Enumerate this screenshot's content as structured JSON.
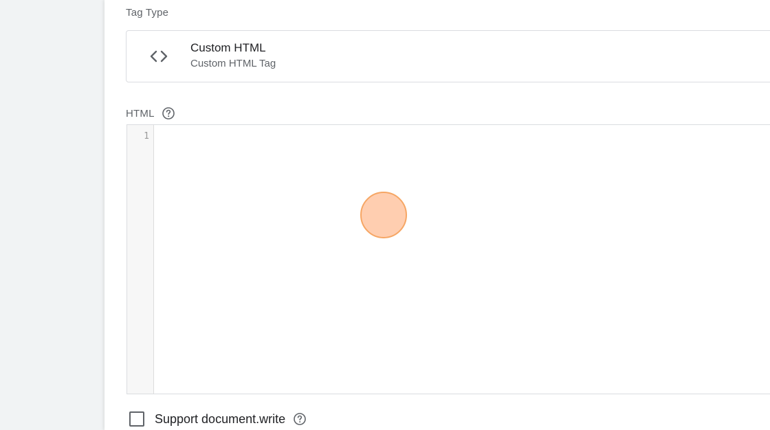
{
  "tag_type": {
    "section_label": "Tag Type",
    "title": "Custom HTML",
    "subtitle": "Custom HTML Tag",
    "icon": "code-brackets-icon"
  },
  "html_section": {
    "label": "HTML",
    "help_icon": "help-circle-icon"
  },
  "editor": {
    "line_numbers": [
      "1"
    ],
    "content": ""
  },
  "support_document_write": {
    "label": "Support document.write",
    "checked": false,
    "help_icon": "help-circle-icon"
  },
  "colors": {
    "panel_background": "#ffffff",
    "page_background": "#f1f3f4",
    "border": "#dadce0",
    "primary_text": "#202124",
    "secondary_text": "#5f6368",
    "click_marker_fill": "#ffd0b3",
    "click_marker_border": "#f6a664"
  }
}
